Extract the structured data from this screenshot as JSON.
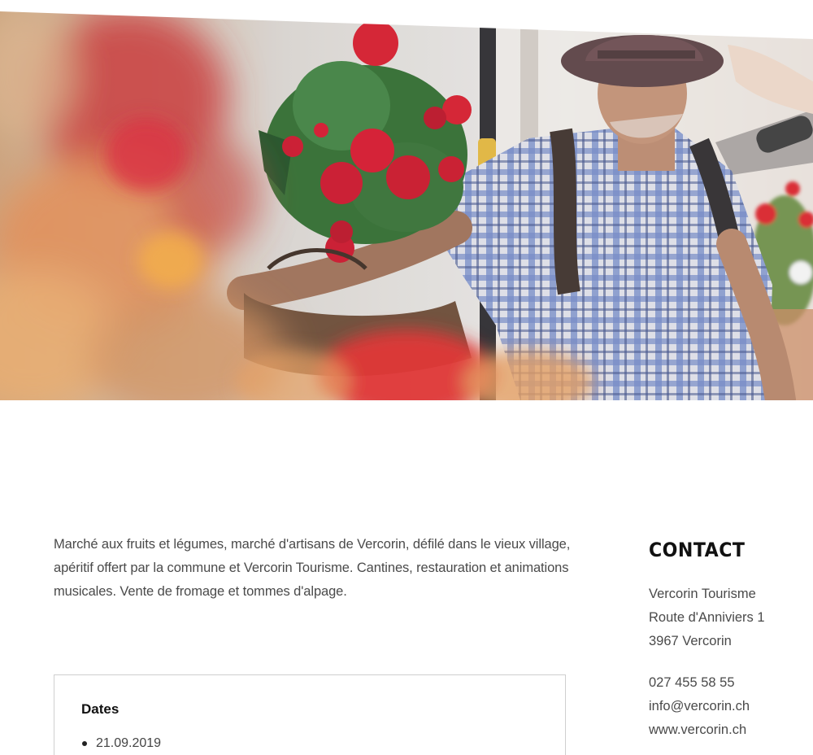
{
  "hero": {
    "image": "market-photo"
  },
  "description": {
    "text": "Marché aux fruits et légumes, marché d'artisans de Vercorin, défilé dans le vieux village, apéritif offert par la commune et Vercorin Tourisme. Cantines, restauration et animations musicales. Vente de fromage et tommes d'alpage."
  },
  "dates": {
    "title": "Dates",
    "items": [
      "21.09.2019"
    ]
  },
  "contact": {
    "title": "CONTACT",
    "name": "Vercorin Tourisme",
    "street": "Route d'Anniviers 1",
    "city": "3967 Vercorin",
    "phone": "027 455 58 55",
    "email": "info@vercorin.ch",
    "website": "www.vercorin.ch"
  }
}
